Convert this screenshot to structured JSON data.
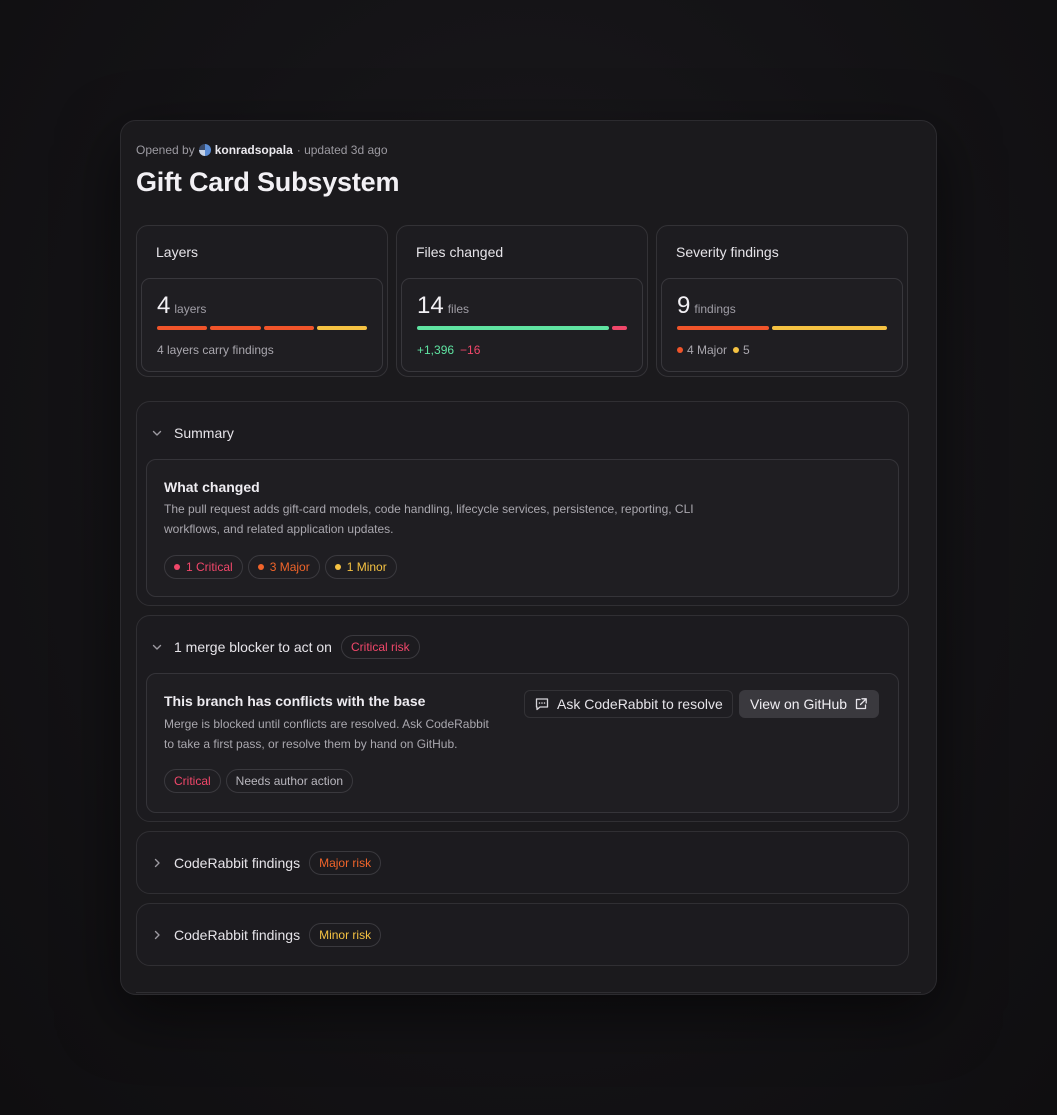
{
  "header": {
    "opened_by_prefix": "Opened by",
    "author": "konradsopala",
    "updated": "· updated 3d ago",
    "title": "Gift Card Subsystem"
  },
  "stats": {
    "layers": {
      "label": "Layers",
      "value": "4",
      "unit": "layers",
      "footer": "4 layers carry findings",
      "bar_colors": [
        "#f0542a",
        "#f0542a",
        "#f0542a",
        "#f5c242"
      ]
    },
    "files": {
      "label": "Files changed",
      "value": "14",
      "unit": "files",
      "additions": "+1,396",
      "deletions": "−16",
      "additions_share": 0.987,
      "add_color": "#5fe3a1",
      "del_color": "#f0476a"
    },
    "severity": {
      "label": "Severity findings",
      "value": "9",
      "unit": "findings",
      "major_count_label": "4 Major",
      "minor_count_label": "5",
      "major_share": 0.444,
      "major_color": "#f0542a",
      "minor_color": "#f5c242"
    }
  },
  "summary": {
    "heading": "Summary",
    "what_changed_title": "What changed",
    "what_changed_text_line1": "The pull request adds gift-card models, code handling, lifecycle services, persistence, reporting, CLI",
    "what_changed_text_line2": "workflows, and related application updates.",
    "badges": [
      {
        "label": "1 Critical",
        "color": "#f0476a"
      },
      {
        "label": "3 Major",
        "color": "#f0642a"
      },
      {
        "label": "1 Minor",
        "color": "#f5c242"
      }
    ]
  },
  "blocker": {
    "heading": "1 merge blocker to act on",
    "risk_label": "Critical risk",
    "risk_color": "#f0476a",
    "title": "This branch has conflicts with the base",
    "text_line1": "Merge is blocked until conflicts are resolved. Ask CodeRabbit",
    "text_line2": "to take a first pass, or resolve them by hand on GitHub.",
    "ask_button": "Ask CodeRabbit to resolve",
    "github_button": "View on GitHub",
    "tags": [
      {
        "label": "Critical",
        "color": "#f0476a"
      },
      {
        "label": "Needs author action",
        "color": "#b9b7be"
      }
    ]
  },
  "findings": [
    {
      "heading": "CodeRabbit findings",
      "risk_label": "Major risk",
      "risk_color": "#f0642a"
    },
    {
      "heading": "CodeRabbit findings",
      "risk_label": "Minor risk",
      "risk_color": "#f5c242"
    }
  ],
  "icons": {
    "chevron_down": "chevron-down-icon",
    "chevron_right": "chevron-right-icon",
    "comment": "comment-icon",
    "external_link": "external-link-icon"
  }
}
